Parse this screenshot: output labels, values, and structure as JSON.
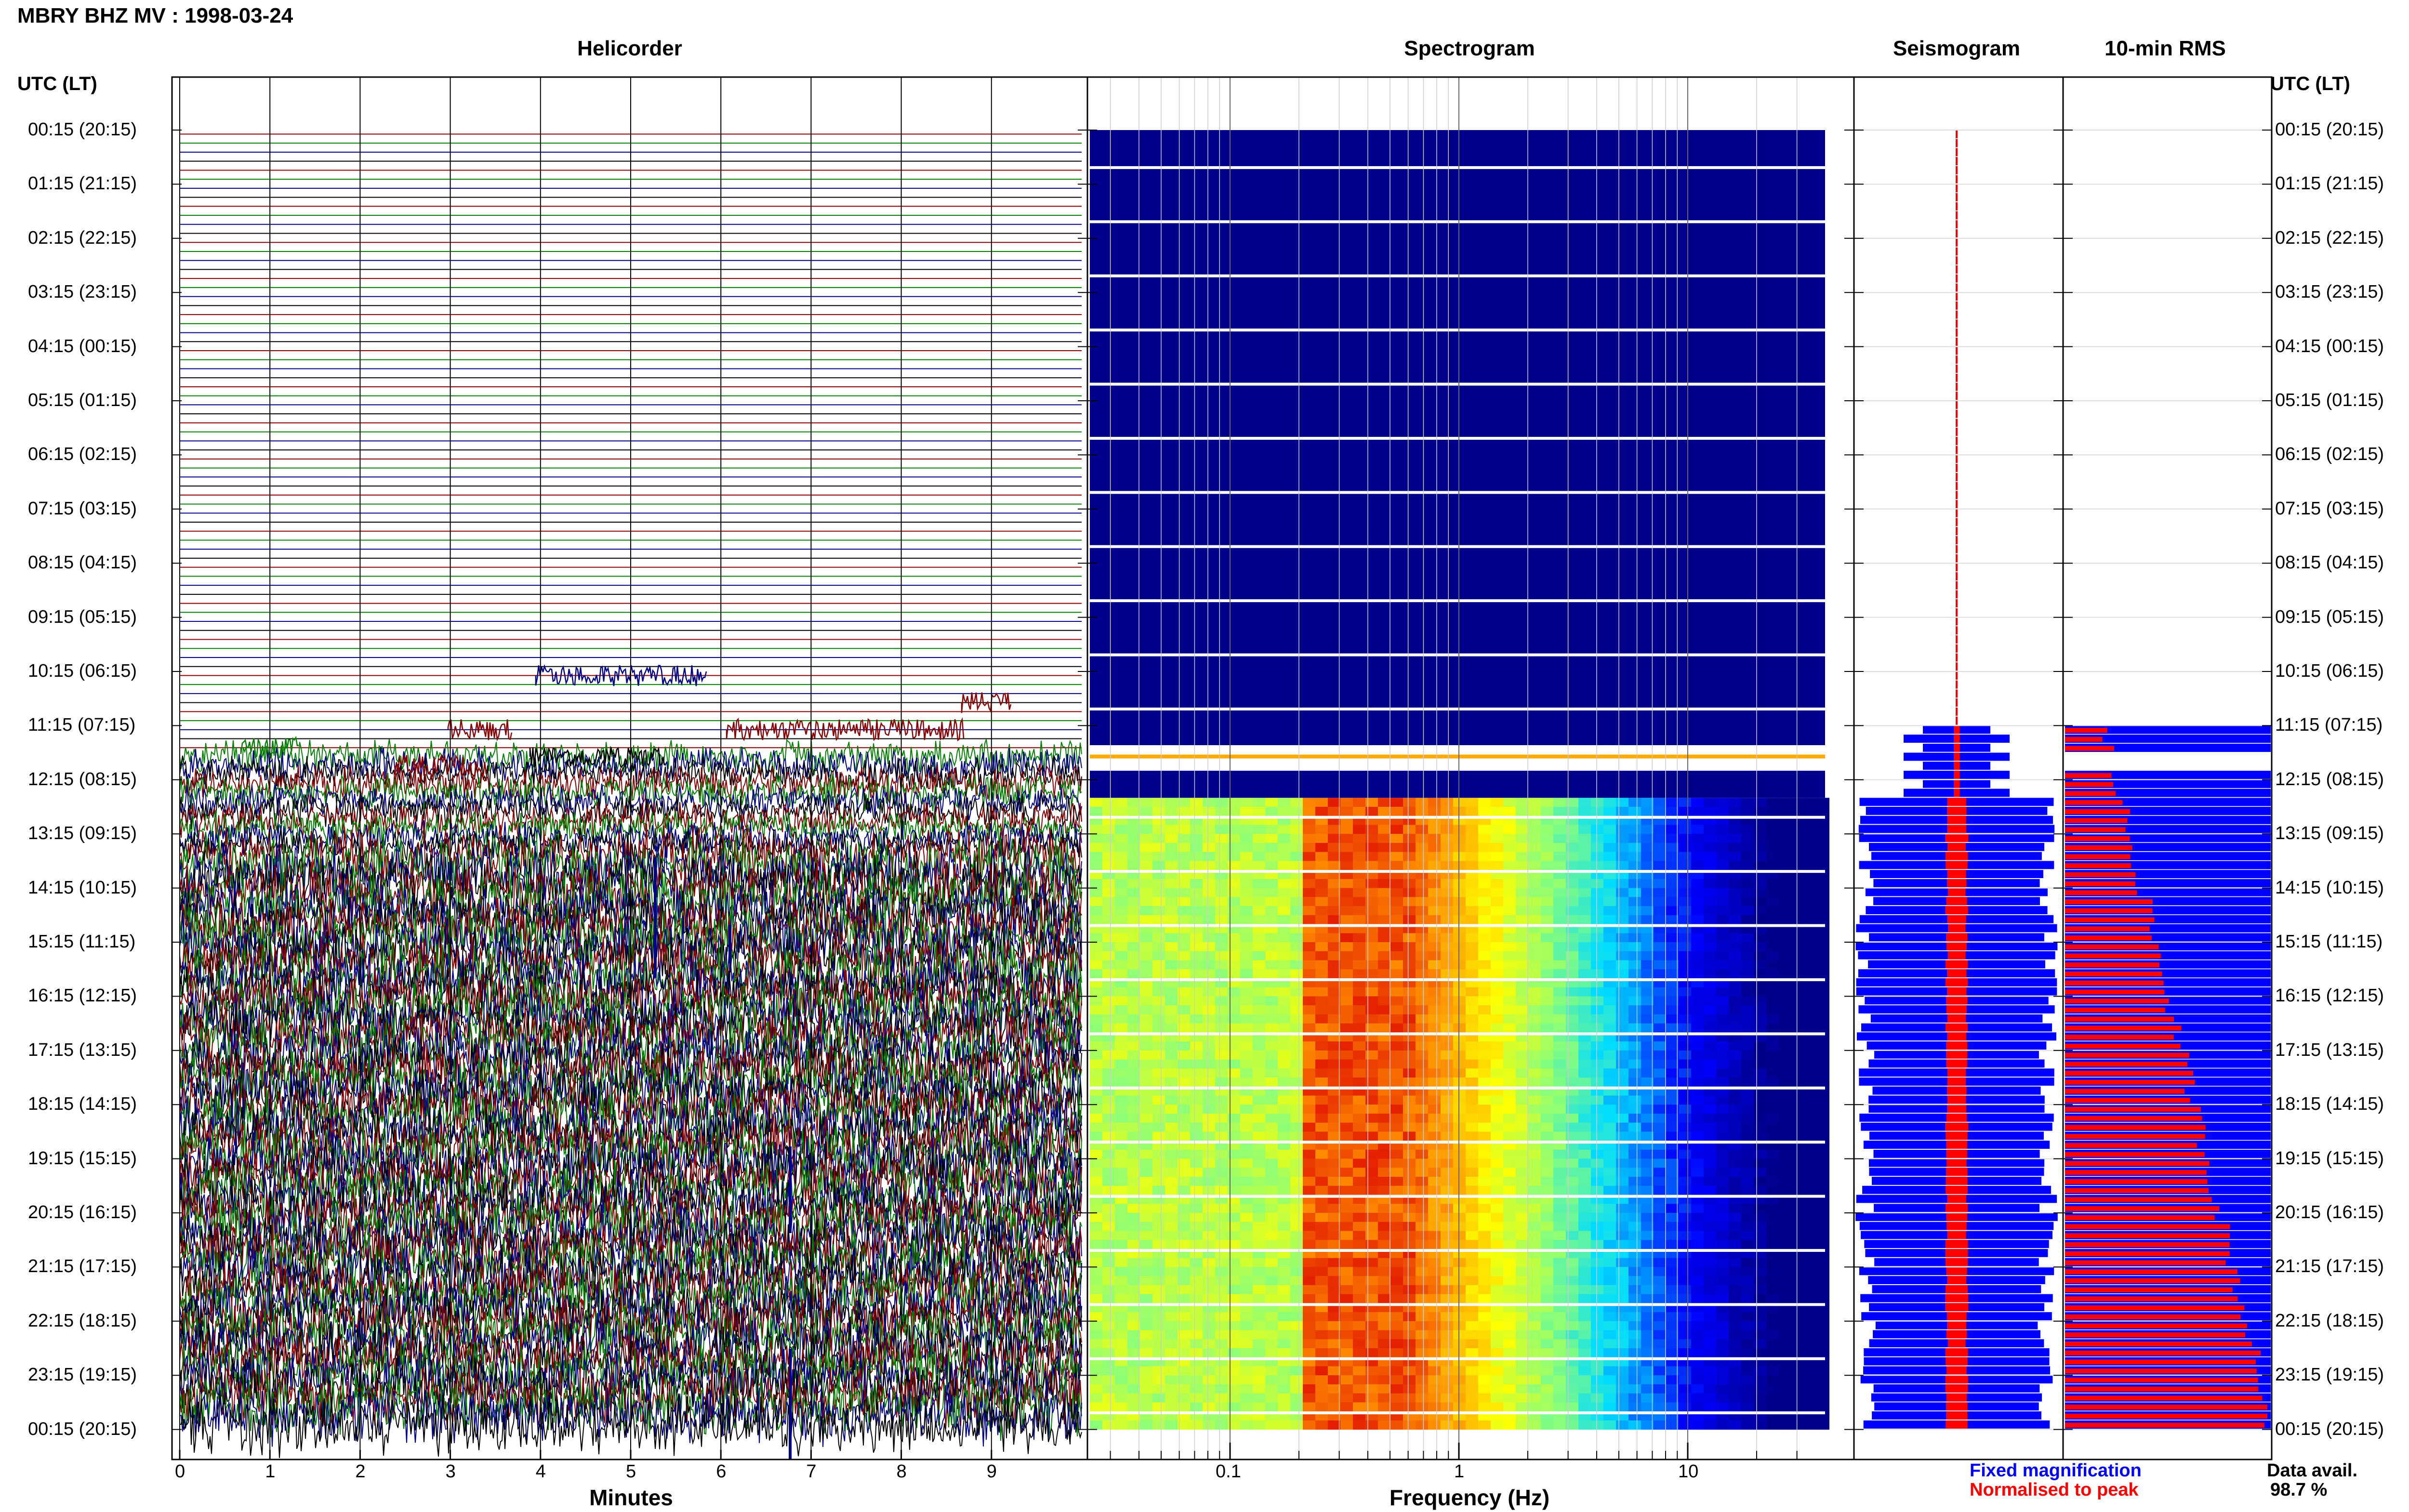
{
  "station_title": "MBRY BHZ MV : 1998-03-24",
  "panels": {
    "helicorder": "Helicorder",
    "spectrogram": "Spectrogram",
    "seismogram": "Seismogram",
    "rms": "10-min RMS"
  },
  "time_axis_label": "UTC (LT)",
  "time_ticks": [
    "00:15 (20:15)",
    "01:15 (21:15)",
    "02:15 (22:15)",
    "03:15 (23:15)",
    "04:15 (00:15)",
    "05:15 (01:15)",
    "06:15 (02:15)",
    "07:15 (03:15)",
    "08:15 (04:15)",
    "09:15 (05:15)",
    "10:15 (06:15)",
    "11:15 (07:15)",
    "12:15 (08:15)",
    "13:15 (09:15)",
    "14:15 (10:15)",
    "15:15 (11:15)",
    "16:15 (12:15)",
    "17:15 (13:15)",
    "18:15 (14:15)",
    "19:15 (15:15)",
    "20:15 (16:15)",
    "21:15 (17:15)",
    "22:15 (18:15)",
    "23:15 (19:15)",
    "00:15 (20:15)"
  ],
  "minutes_axis": {
    "label": "Minutes",
    "ticks": [
      "0",
      "1",
      "2",
      "3",
      "4",
      "5",
      "6",
      "7",
      "8",
      "9"
    ]
  },
  "frequency_axis": {
    "label": "Frequency (Hz)",
    "ticks": [
      "0.1",
      "1",
      "10"
    ],
    "scale": "log"
  },
  "legend": {
    "fixed": "Fixed magnification",
    "fixed_color": "#0000ff",
    "normalised": "Normalised to peak",
    "normalised_color": "#ff0000"
  },
  "data_availability": {
    "label": "Data avail.",
    "value": "98.7 %"
  },
  "colors": {
    "trace_cycle": [
      "#8b0000",
      "#008000",
      "#00008b",
      "#000000"
    ],
    "spectrogram_background": "#00008b",
    "fixed": "#0000ff",
    "normalised": "#ff0000"
  },
  "chart_data": {
    "type": "heatmap",
    "rows": 144,
    "row_interval_minutes": 10,
    "quiet_until_utc": "11:15",
    "active_from_utc": "11:15",
    "data_gap_utc": [
      "11:55",
      "12:25"
    ],
    "spectral_peak_hz": [
      0.2,
      0.5
    ],
    "frequency_range_hz": [
      0.02,
      40
    ],
    "data_availability_percent": 98.7
  }
}
